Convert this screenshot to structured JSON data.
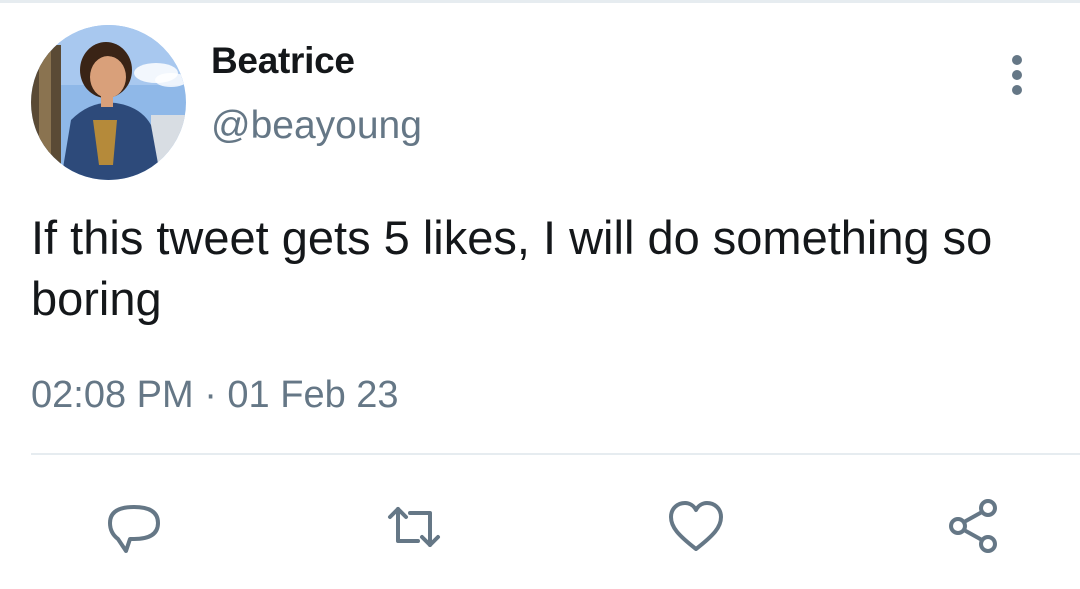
{
  "tweet": {
    "display_name": "Beatrice",
    "handle": "@beayoung",
    "text": "If this tweet gets 5 likes, I will do something so boring",
    "timestamp": "02:08 PM · 01 Feb 23"
  },
  "icons": {
    "more": "more-vertical-icon",
    "reply": "reply-bubble-icon",
    "retweet": "retweet-icon",
    "like": "heart-icon",
    "share": "share-icon"
  },
  "colors": {
    "text_primary": "#14171a",
    "text_secondary": "#657786",
    "icon": "#657786",
    "divider": "#e6ecf0"
  }
}
